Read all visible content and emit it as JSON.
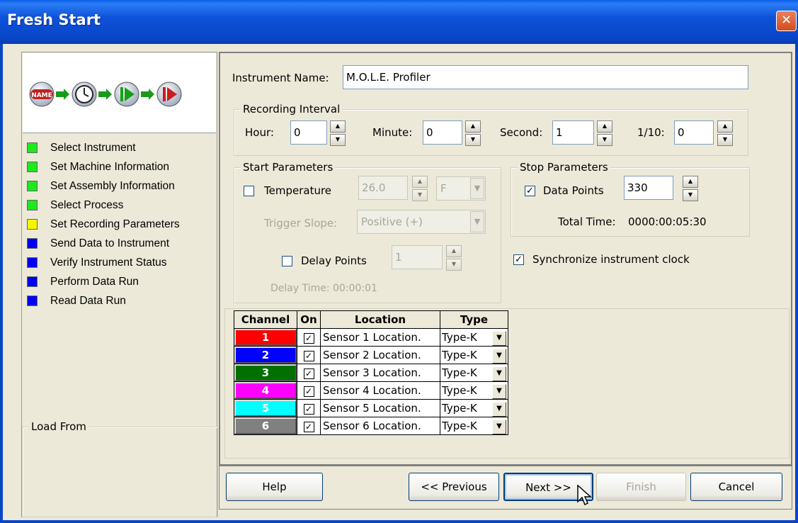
{
  "window": {
    "title": "Fresh Start",
    "close_glyph": "✕"
  },
  "workflow_icons": {
    "name_badge": "NAME"
  },
  "steps": [
    {
      "label": "Select Instrument",
      "color": "#1ee81e"
    },
    {
      "label": "Set Machine Information",
      "color": "#1ee81e"
    },
    {
      "label": "Set Assembly Information",
      "color": "#1ee81e"
    },
    {
      "label": "Select Process",
      "color": "#1ee81e"
    },
    {
      "label": "Set Recording Parameters",
      "color": "#f5f500"
    },
    {
      "label": "Send Data to Instrument",
      "color": "#0000f0"
    },
    {
      "label": "Verify Instrument Status",
      "color": "#0000f0"
    },
    {
      "label": "Perform Data Run",
      "color": "#0000f0"
    },
    {
      "label": "Read Data Run",
      "color": "#0000f0"
    }
  ],
  "load_from": {
    "legend": "Load From"
  },
  "instrument": {
    "label": "Instrument Name:",
    "value": "M.O.L.E. Profiler"
  },
  "recording_interval": {
    "legend": "Recording Interval",
    "hour_label": "Hour:",
    "hour": "0",
    "minute_label": "Minute:",
    "minute": "0",
    "second_label": "Second:",
    "second": "1",
    "tenth_label": "1/10:",
    "tenth": "0"
  },
  "start_parameters": {
    "legend": "Start Parameters",
    "temperature_label": "Temperature",
    "temperature_checked": false,
    "temperature_value": "26.0",
    "unit": "F",
    "trigger_slope_label": "Trigger Slope:",
    "trigger_slope": "Positive (+)",
    "delay_points_label": "Delay Points",
    "delay_points_checked": false,
    "delay_points": "1",
    "delay_time": "Delay Time:  00:00:01"
  },
  "stop_parameters": {
    "legend": "Stop Parameters",
    "data_points_label": "Data Points",
    "data_points_checked": true,
    "data_points": "330",
    "total_time_label": "Total Time:",
    "total_time": "0000:00:05:30"
  },
  "sync_clock": {
    "label": "Synchronize instrument clock",
    "checked": true
  },
  "channel_table": {
    "headers": [
      "Channel",
      "On",
      "Location",
      "Type"
    ],
    "rows": [
      {
        "channel": "1",
        "color": "#ff0000",
        "on": true,
        "location": "Sensor 1 Location.",
        "type": "Type-K"
      },
      {
        "channel": "2",
        "color": "#0000ff",
        "on": true,
        "location": "Sensor 2 Location.",
        "type": "Type-K"
      },
      {
        "channel": "3",
        "color": "#007000",
        "on": true,
        "location": "Sensor 3 Location.",
        "type": "Type-K"
      },
      {
        "channel": "4",
        "color": "#ff00ff",
        "on": true,
        "location": "Sensor 4 Location.",
        "type": "Type-K"
      },
      {
        "channel": "5",
        "color": "#00ffff",
        "on": true,
        "location": "Sensor 5 Location.",
        "type": "Type-K"
      },
      {
        "channel": "6",
        "color": "#808080",
        "on": true,
        "location": "Sensor 6 Location.",
        "type": "Type-K"
      }
    ]
  },
  "buttons": {
    "help": "Help",
    "previous": "<< Previous",
    "next": "Next >>",
    "finish": "Finish",
    "cancel": "Cancel"
  }
}
